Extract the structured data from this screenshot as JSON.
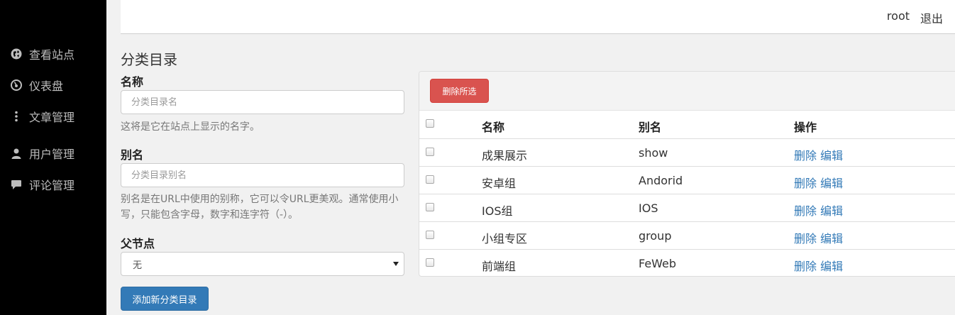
{
  "sidebar": {
    "items": [
      {
        "label": "查看站点",
        "icon": "globe-icon"
      },
      {
        "label": "仪表盘",
        "icon": "dashboard-icon"
      },
      {
        "label": "文章管理",
        "icon": "more-vertical-icon"
      },
      {
        "label": "用户管理",
        "icon": "user-icon"
      },
      {
        "label": "评论管理",
        "icon": "comment-icon"
      }
    ]
  },
  "header": {
    "username": "root",
    "logout_label": "退出"
  },
  "page": {
    "title": "分类目录"
  },
  "form": {
    "name_label": "名称",
    "name_placeholder": "分类目录名",
    "name_help": "这将是它在站点上显示的名字。",
    "slug_label": "别名",
    "slug_placeholder": "分类目录别名",
    "slug_help": "别名是在URL中使用的别称，它可以令URL更美观。通常使用小写，只能包含字母，数字和连字符（-）。",
    "parent_label": "父节点",
    "parent_selected": "无",
    "submit_label": "添加新分类目录"
  },
  "table": {
    "delete_selected_label": "删除所选",
    "headers": {
      "name": "名称",
      "slug": "别名",
      "actions": "操作"
    },
    "rows": [
      {
        "name": "成果展示",
        "slug": "show",
        "delete": "删除",
        "edit": "编辑"
      },
      {
        "name": "安卓组",
        "slug": "Andorid",
        "delete": "删除",
        "edit": "编辑"
      },
      {
        "name": "IOS组",
        "slug": "IOS",
        "delete": "删除",
        "edit": "编辑"
      },
      {
        "name": "小组专区",
        "slug": "group",
        "delete": "删除",
        "edit": "编辑"
      },
      {
        "name": "前端组",
        "slug": "FeWeb",
        "delete": "删除",
        "edit": "编辑"
      }
    ]
  }
}
